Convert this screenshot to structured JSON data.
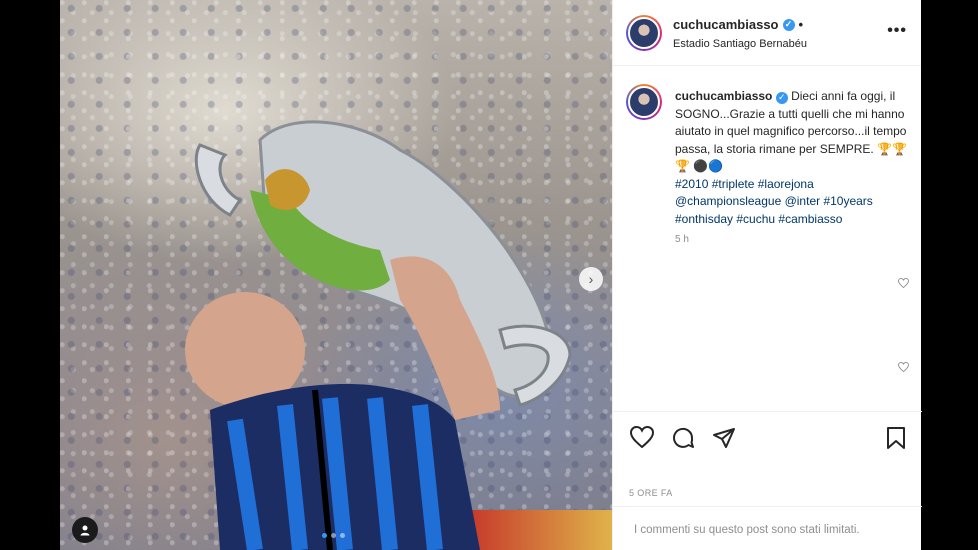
{
  "post": {
    "username": "cuchucambiasso",
    "verified_icon": "✓",
    "dot": "•",
    "location": "Estadio Santiago Bernabéu",
    "more_icon": "•••"
  },
  "caption": {
    "username": "cuchucambiasso",
    "text": "Dieci anni fa oggi, il SOGNO...Grazie a tutti quelli che mi hanno aiutato in quel magnifico percorso...il tempo passa, la storia rimane per SEMPRE. 🏆🏆🏆 ⚫🔵",
    "tags_line1": "#2010 #triplete #laorejona",
    "tags_line2": "@championsleague @inter #10years",
    "tags_line3": "#onthisday #cuchu #cambiasso",
    "time": "5 h"
  },
  "post_time": "5 ORE FA",
  "limited_comments": "I commenti su questo post sono stati limitati.",
  "media": {
    "next_icon": "›",
    "carousel_count": 3,
    "active_index": 0
  },
  "icons": {
    "like": "heart-icon",
    "comment": "comment-icon",
    "share": "share-icon",
    "save": "bookmark-icon",
    "tag": "user-tag-icon"
  },
  "colors": {
    "link": "#00376b",
    "verified": "#3897f0",
    "muted": "#8e8e8e"
  }
}
